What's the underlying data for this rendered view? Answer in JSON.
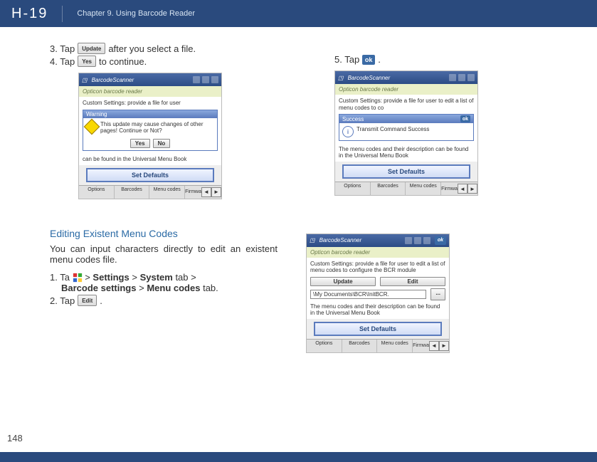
{
  "header": {
    "model": "H-19",
    "chapter": "Chapter 9. Using Barcode Reader"
  },
  "page_number": "148",
  "sec1": {
    "step3_pre": "3. Tap",
    "step3_btn": "Update",
    "step3_post": "after you select a file.",
    "step4_pre": "4. Tap",
    "step4_btn": "Yes",
    "step4_post": "to continue.",
    "step5_pre": "5. Tap",
    "step5_btn": "ok",
    "step5_post": "."
  },
  "shotA": {
    "title": "BarcodeScanner",
    "subtitle": "Opticon barcode reader",
    "para": "Custom Settings: provide a file for user",
    "dlg_head": "Warning",
    "dlg_msg": "This update may cause changes of other pages! Continue or Not?",
    "yes": "Yes",
    "no": "No",
    "note": "can be found in the Universal Menu Book",
    "defaults": "Set Defaults",
    "tabs": [
      "Options",
      "Barcodes",
      "Menu codes",
      "Firmwa"
    ]
  },
  "shotB": {
    "title": "BarcodeScanner",
    "subtitle": "Opticon barcode reader",
    "para": "Custom Settings: provide a file for user to edit a list of menu codes to co",
    "dlg_head": "Success",
    "dlg_msg": "Transmit Command Success",
    "note": "The menu codes and their description can be found in the Universal Menu Book",
    "defaults": "Set Defaults",
    "tabs": [
      "Options",
      "Barcodes",
      "Menu codes",
      "Firmwa"
    ]
  },
  "sec2": {
    "heading": "Editing Existent Menu Codes",
    "para": "You can input characters directly to edit an existent menu codes file.",
    "step1_a": "1. Ta",
    "step1_b": ">",
    "settings": "Settings",
    "system": "System",
    "tab": "tab",
    "step1_c": ">",
    "bcs": "Barcode settings",
    "mc": "Menu codes",
    "tab2": "tab.",
    "step2_pre": "2. Tap",
    "step2_btn": "Edit",
    "step2_post": "."
  },
  "shotC": {
    "title": "BarcodeScanner",
    "subtitle": "Opticon barcode reader",
    "para": "Custom Settings: provide a file for user to edit a list of menu codes to configure the BCR module",
    "update": "Update",
    "edit": "Edit",
    "path": "\\My Documents\\BCR\\InitBCR.",
    "dots": "...",
    "note": "The menu codes and their description can be found in the Universal Menu Book",
    "defaults": "Set Defaults",
    "tabs": [
      "Options",
      "Barcodes",
      "Menu codes",
      "Firmwa"
    ]
  }
}
